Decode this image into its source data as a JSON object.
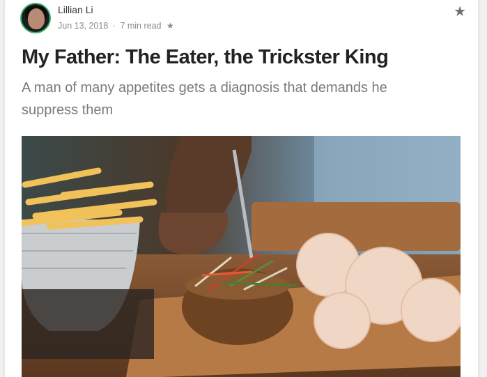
{
  "author": {
    "name": "Lillian Li",
    "date": "Jun 13, 2018",
    "separator": "·",
    "read_time": "7 min read",
    "read_star": "★"
  },
  "bookmark_icon": "★",
  "icons": {
    "bookmark": "star-icon",
    "member_only": "star-icon"
  },
  "article": {
    "title": "My Father: The Eater, the Trickster King",
    "subtitle": "A man of many appetites gets a diagnosis that demands he suppress them"
  },
  "colors": {
    "avatar_ring": "#3cb371",
    "title": "#222222",
    "subtitle": "#7a7a7a",
    "meta": "#8a8a8a"
  }
}
